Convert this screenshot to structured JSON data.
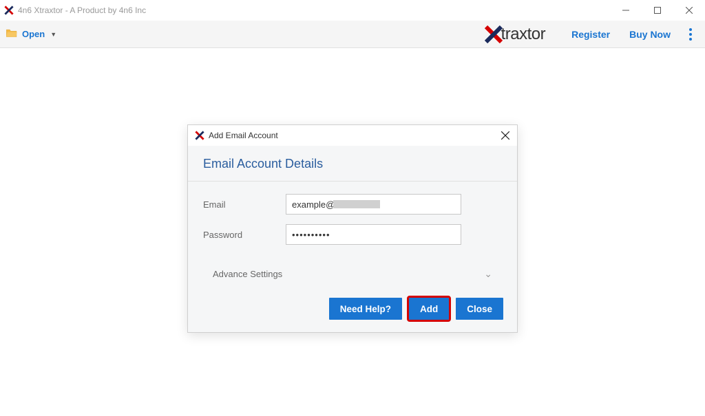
{
  "window": {
    "title": "4n6 Xtraxtor - A Product by 4n6 Inc"
  },
  "toolbar": {
    "open_label": "Open",
    "register_label": "Register",
    "buy_now_label": "Buy Now",
    "brand_text": "traxtor"
  },
  "dialog": {
    "title": "Add Email Account",
    "section_header": "Email Account Details",
    "email_label": "Email",
    "email_value_prefix": "example@",
    "password_label": "Password",
    "password_value": "••••••••••",
    "advance_label": "Advance Settings",
    "need_help_label": "Need Help?",
    "add_label": "Add",
    "close_label": "Close"
  }
}
